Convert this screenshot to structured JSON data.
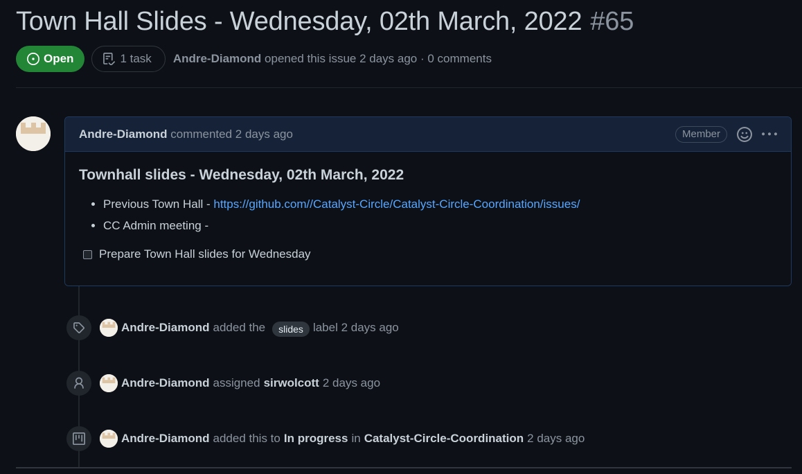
{
  "issue": {
    "title": "Town Hall Slides - Wednesday, 02th March, 2022",
    "number": "#65",
    "state": "Open",
    "tasks": "1 task",
    "author": "Andre-Diamond",
    "opened_text": "opened this issue 2 days ago · 0 comments"
  },
  "comment": {
    "author": "Andre-Diamond",
    "action": "commented 2 days ago",
    "role_badge": "Member",
    "heading": "Townhall slides - Wednesday, 02th March, 2022",
    "list": [
      {
        "label": "Previous Town Hall - ",
        "link": "https://github.com//Catalyst-Circle/Catalyst-Circle-Coordination/issues/"
      },
      {
        "label": "CC Admin meeting -",
        "link": ""
      }
    ],
    "task_item": "Prepare Town Hall slides for Wednesday"
  },
  "timeline": {
    "label_event": {
      "author": "Andre-Diamond",
      "pre": "added the",
      "label": "slides",
      "post": "label 2 days ago"
    },
    "assign_event": {
      "author": "Andre-Diamond",
      "pre": "assigned",
      "assignee": "sirwolcott",
      "post": "2 days ago"
    },
    "project_event": {
      "author": "Andre-Diamond",
      "pre": "added this to",
      "column": "In progress",
      "mid": "in",
      "project": "Catalyst-Circle-Coordination",
      "post": "2 days ago"
    }
  },
  "icons": {
    "state": "issue-opened-icon",
    "tasks": "checklist-icon",
    "reaction": "smiley-icon",
    "more": "kebab-horizontal-icon",
    "label_event": "tag-icon",
    "assign_event": "person-icon",
    "project_event": "project-icon"
  },
  "colors": {
    "background": "#0d1117",
    "open_green": "#238636",
    "link_blue": "#58a6ff",
    "comment_header": "#152238",
    "comment_border": "#1f3a5f"
  }
}
